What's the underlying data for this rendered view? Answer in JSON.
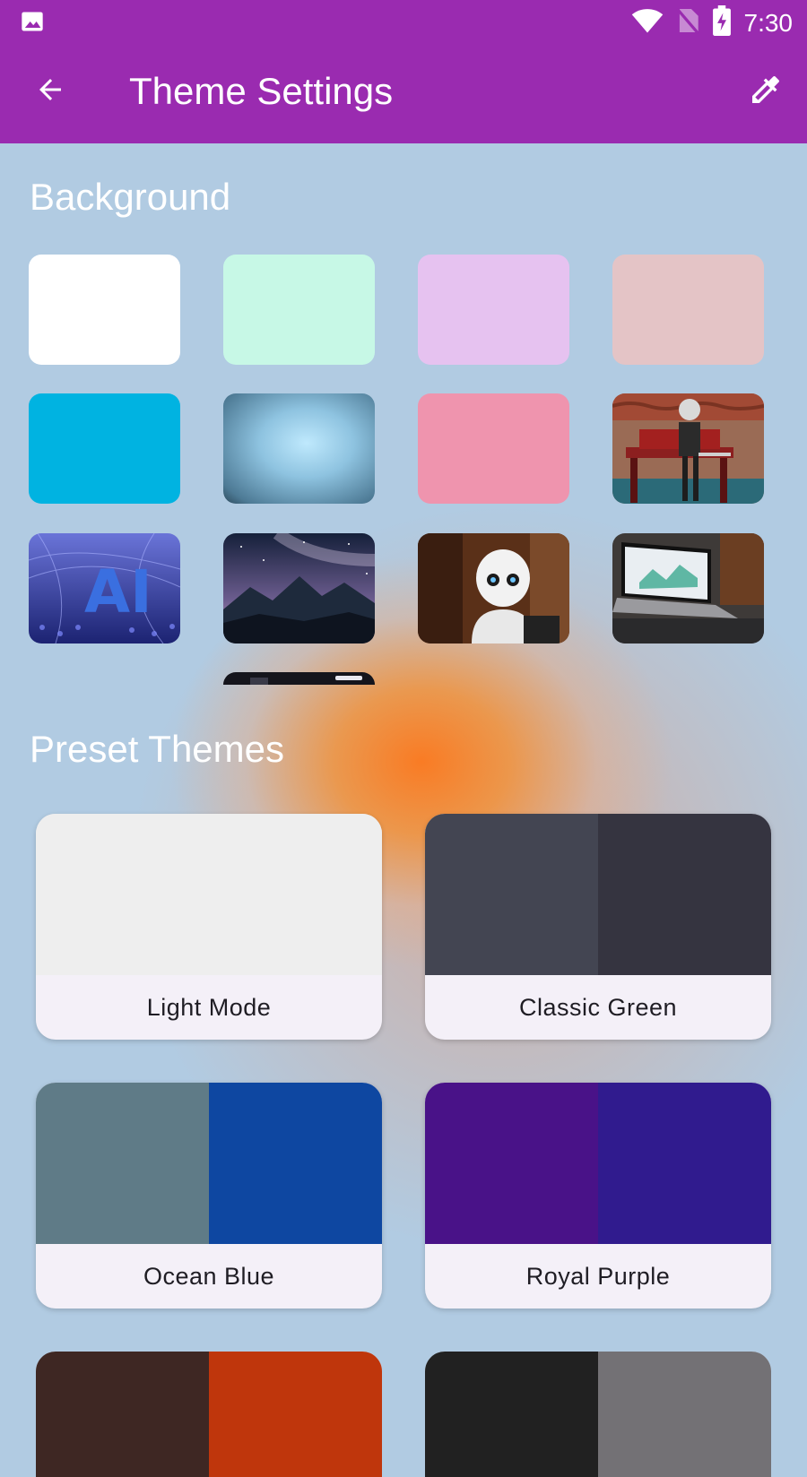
{
  "status_bar": {
    "time": "7:30",
    "icons": [
      "image-icon",
      "wifi-icon",
      "no-sim-icon",
      "battery-charging-icon"
    ]
  },
  "app_bar": {
    "title": "Theme Settings",
    "back_icon": "arrow-back-icon",
    "action_icon": "color-picker-icon",
    "color": "#9a2bb0"
  },
  "background_section": {
    "title": "Background",
    "swatches": [
      {
        "name": "white",
        "color": "#ffffff"
      },
      {
        "name": "mint",
        "color": "#c7f8e6"
      },
      {
        "name": "lavender",
        "color": "#e6c2f0"
      },
      {
        "name": "rose",
        "color": "#e4c4c6"
      },
      {
        "name": "cyan",
        "color": "#00b3e1"
      },
      {
        "name": "blue-radial",
        "color": "#b8e4fb"
      },
      {
        "name": "pink",
        "color": "#ef94ae"
      },
      {
        "name": "robot-bench-image",
        "color": "#8a4a3a"
      },
      {
        "name": "ai-image",
        "color": "#3d47b8"
      },
      {
        "name": "night-mountains-image",
        "color": "#1f2b4a"
      },
      {
        "name": "robot-pepper-image",
        "color": "#6b3a24"
      },
      {
        "name": "laptop-image",
        "color": "#5a5a5e"
      },
      {
        "name": "dark-partial-image",
        "color": "#15151c"
      }
    ]
  },
  "preset_section": {
    "title": "Preset Themes",
    "themes": [
      {
        "label": "Light Mode",
        "colors": [
          "#eeeeee",
          "#eeeeee"
        ]
      },
      {
        "label": "Classic Green",
        "colors": [
          "#434552",
          "#353440"
        ]
      },
      {
        "label": "Ocean Blue",
        "colors": [
          "#5f7b87",
          "#0e47a1"
        ]
      },
      {
        "label": "Royal Purple",
        "colors": [
          "#491288",
          "#301b8e"
        ]
      },
      {
        "label": "",
        "colors": [
          "#3e2723",
          "#bf360c"
        ]
      },
      {
        "label": "",
        "colors": [
          "#212121",
          "#737175"
        ]
      }
    ]
  }
}
